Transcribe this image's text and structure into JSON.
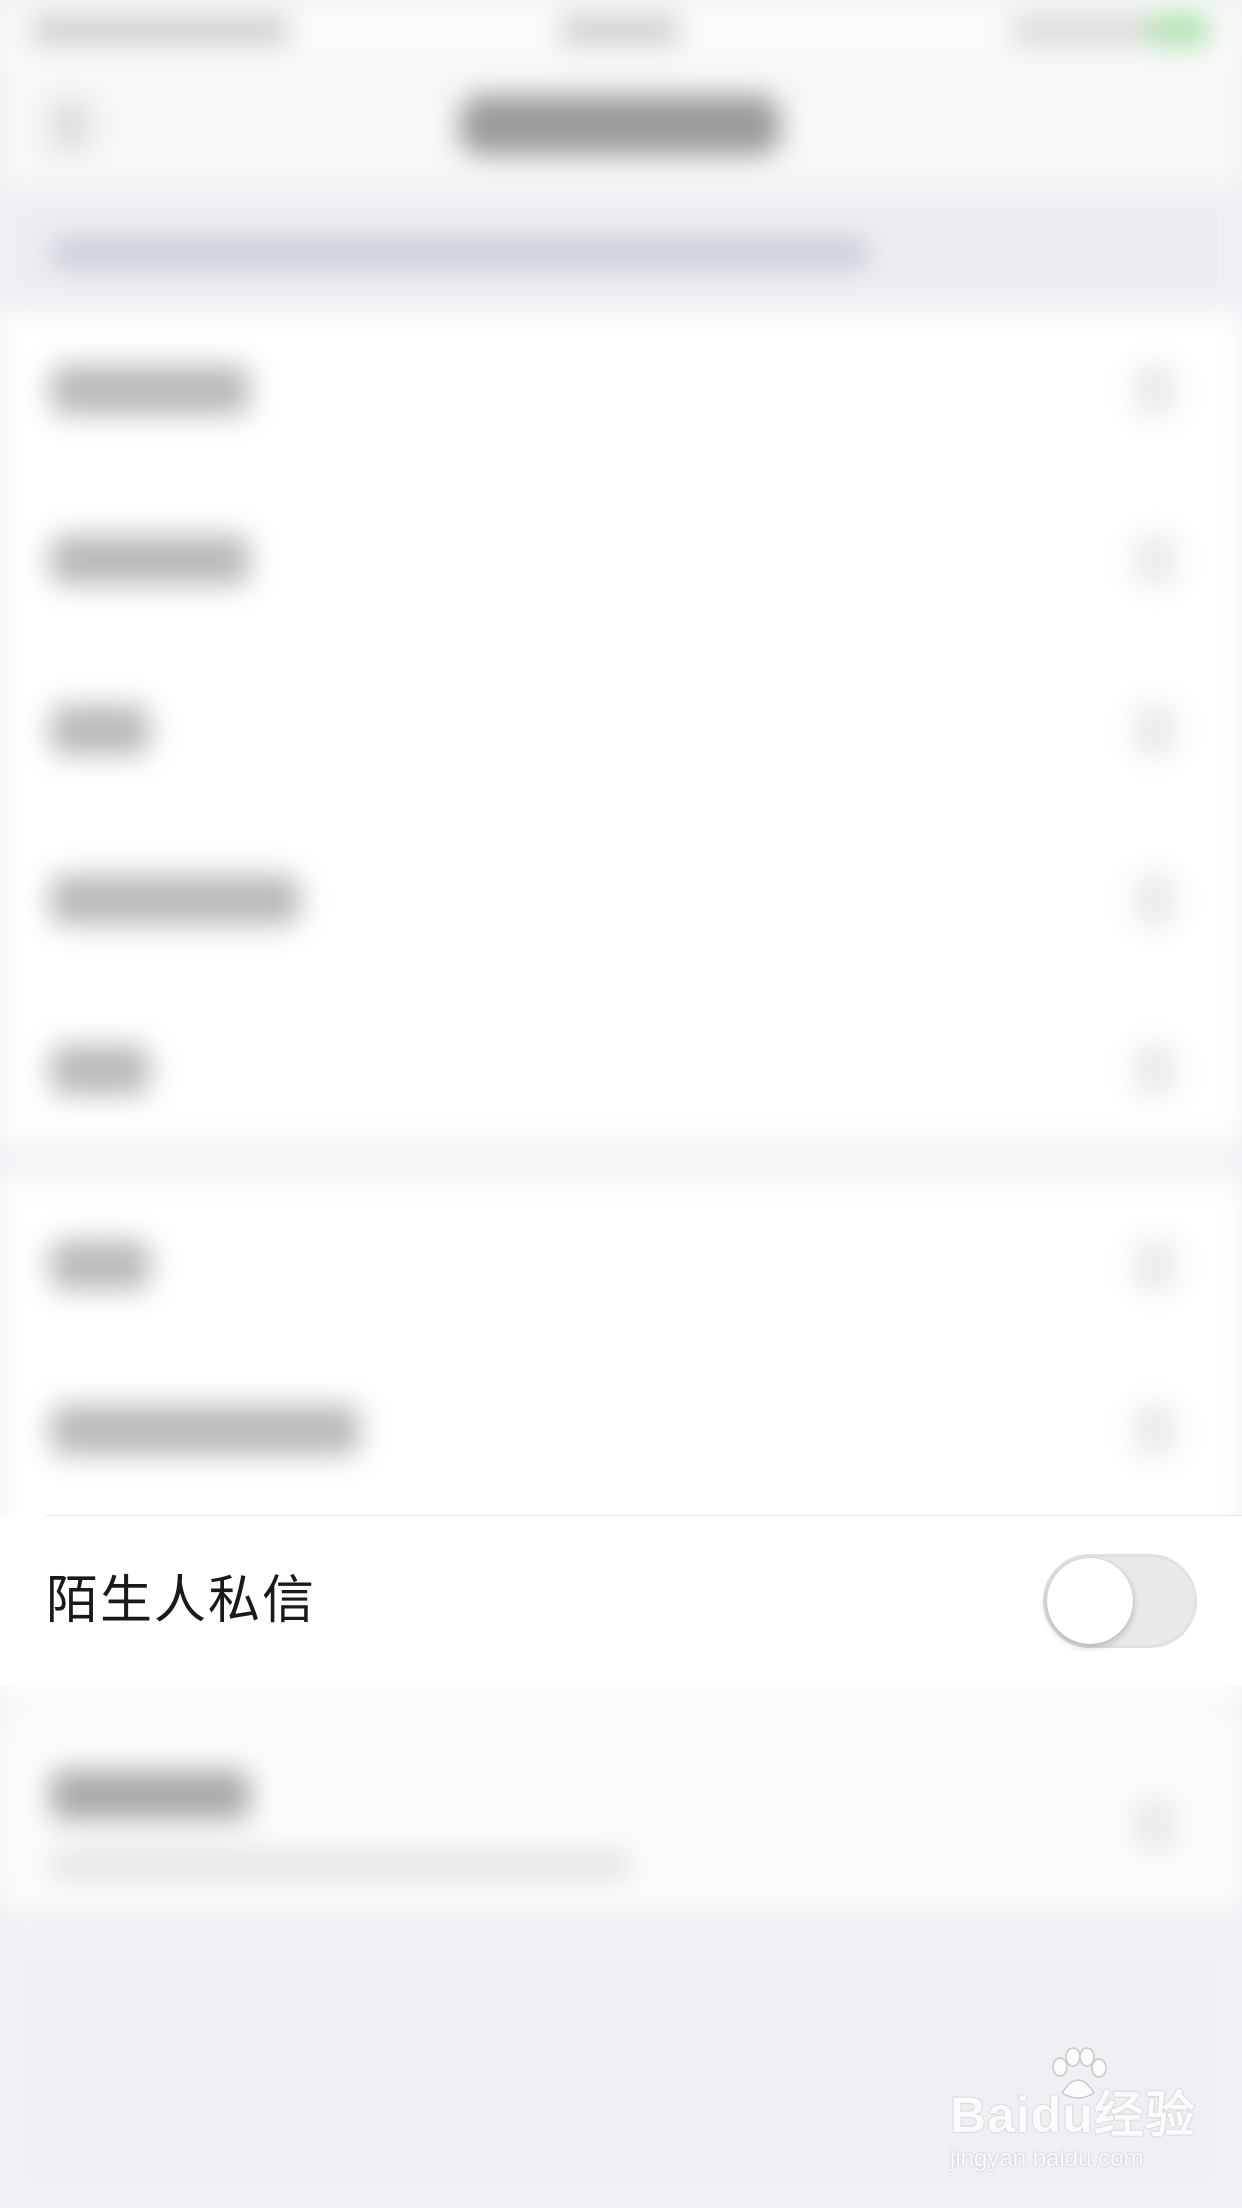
{
  "stranger_message": {
    "label": "陌生人私信",
    "enabled": false
  },
  "watermark": {
    "logo_text": "Baidu经验",
    "url_text": "jingyan.baidu.com"
  },
  "colors": {
    "background": "#f0f1f5",
    "row_background": "#ffffff",
    "toggle_off_track": "#e9e9ea",
    "toggle_knob": "#ffffff",
    "label_text": "#1a1a1a"
  }
}
